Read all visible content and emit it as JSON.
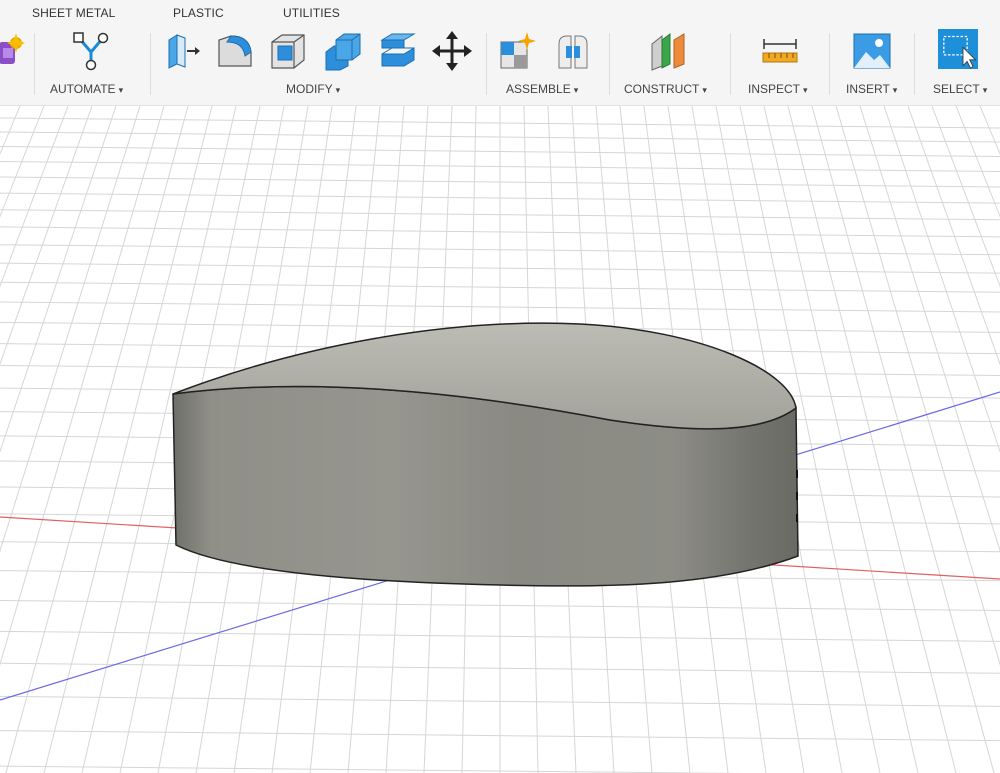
{
  "tabs": {
    "sheet_metal": "SHEET METAL",
    "plastic": "PLASTIC",
    "utilities": "UTILITIES"
  },
  "groups": {
    "automate": "AUTOMATE",
    "modify": "MODIFY",
    "assemble": "ASSEMBLE",
    "construct": "CONSTRUCT",
    "inspect": "INSPECT",
    "insert": "INSERT",
    "select": "SELECT"
  },
  "caret": "▾",
  "icons": {
    "partial_left": "create-form-icon",
    "automate": "automate-icon",
    "modify": [
      "press-pull-icon",
      "fillet-icon",
      "shell-icon",
      "combine-icon",
      "offset-face-icon",
      "move-icon"
    ],
    "assemble": [
      "new-component-icon",
      "joint-icon"
    ],
    "construct": "offset-plane-icon",
    "inspect": "measure-icon",
    "insert": "insert-image-icon",
    "select": "select-icon"
  },
  "colors": {
    "toolbar_bg": "#f5f5f5",
    "accent_blue": "#1b8ad6",
    "select_bg": "#1e90d9",
    "body_gray": "#8d8d87",
    "x_axis": "#e06060",
    "z_axis": "#6a6ae6"
  }
}
